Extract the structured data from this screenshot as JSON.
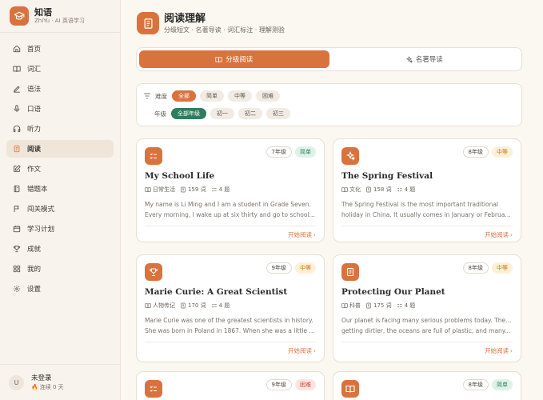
{
  "app": {
    "name": "知语",
    "subtitle": "ZhiYu · AI 英语学习"
  },
  "sidebar": {
    "items": [
      {
        "label": "首页",
        "icon": "home-icon"
      },
      {
        "label": "词汇",
        "icon": "book-open-icon"
      },
      {
        "label": "语法",
        "icon": "pencil-icon"
      },
      {
        "label": "口语",
        "icon": "mic-icon"
      },
      {
        "label": "听力",
        "icon": "headphones-icon"
      },
      {
        "label": "阅读",
        "icon": "document-icon",
        "active": true
      },
      {
        "label": "作文",
        "icon": "edit-icon"
      },
      {
        "label": "错题本",
        "icon": "notebook-icon"
      },
      {
        "label": "闯关模式",
        "icon": "flag-icon"
      },
      {
        "label": "学习计划",
        "icon": "calendar-icon"
      },
      {
        "label": "成就",
        "icon": "trophy-icon"
      },
      {
        "label": "我的",
        "icon": "grid-icon"
      },
      {
        "label": "设置",
        "icon": "gear-icon"
      }
    ]
  },
  "user": {
    "initial": "U",
    "name": "未登录",
    "streak": "连续 0 天"
  },
  "header": {
    "title": "阅读理解",
    "subtitle": "分级短文 · 名著导读 · 词汇标注 · 理解测验"
  },
  "tabs": [
    {
      "label": "分级阅读",
      "active": true
    },
    {
      "label": "名著导读",
      "active": false
    }
  ],
  "filters": {
    "difficulty_label": "难度",
    "difficulty": [
      "全部",
      "简单",
      "中等",
      "困难"
    ],
    "grade_label": "年级",
    "grades": [
      "全部年级",
      "初一",
      "初二",
      "初三"
    ]
  },
  "cards": [
    {
      "title": "My School Life",
      "grade": "7年级",
      "level": "简单",
      "level_type": "easy",
      "category": "日常生活",
      "words": "159 词",
      "questions": "4 题",
      "excerpt1": "My name is Li Ming and I am a student in Grade Seven.",
      "excerpt2": "Every morning, I wake up at six thirty and go to school by...",
      "link": "开始阅读"
    },
    {
      "title": "The Spring Festival",
      "grade": "8年级",
      "level": "中等",
      "level_type": "mid",
      "category": "文化",
      "words": "158 词",
      "questions": "4 题",
      "excerpt1": "The Spring Festival is the most important traditional",
      "excerpt2": "holiday in China. It usually comes in January or February....",
      "link": "开始阅读"
    },
    {
      "title": "Marie Curie: A Great Scientist",
      "grade": "9年级",
      "level": "中等",
      "level_type": "mid",
      "category": "人物传记",
      "words": "170 词",
      "questions": "4 题",
      "excerpt1": "Marie Curie was one of the greatest scientists in history.",
      "excerpt2": "She was born in Poland in 1867. When she was a little girl,...",
      "link": "开始阅读"
    },
    {
      "title": "Protecting Our Planet",
      "grade": "8年级",
      "level": "中等",
      "level_type": "mid",
      "category": "科普",
      "words": "175 词",
      "questions": "4 题",
      "excerpt1": "Our planet is facing many serious problems today. The air is",
      "excerpt2": "getting dirtier, the oceans are full of plastic, and many...",
      "link": "开始阅读"
    },
    {
      "grade": "9年级",
      "level": "困难",
      "level_type": "hard"
    },
    {
      "grade": "8年级",
      "level": "简单",
      "level_type": "easy"
    }
  ],
  "colors": {
    "accent": "#d9733e",
    "green": "#2f7d5e",
    "background": "#fbf7f1"
  }
}
